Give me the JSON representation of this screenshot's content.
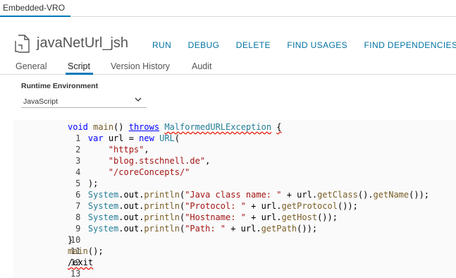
{
  "window": {
    "tab_label": "Embedded-VRO"
  },
  "header": {
    "title": "javaNetUrl_jsh",
    "actions": [
      "RUN",
      "DEBUG",
      "DELETE",
      "FIND USAGES",
      "FIND DEPENDENCIES"
    ]
  },
  "subtabs": [
    "General",
    "Script",
    "Version History",
    "Audit"
  ],
  "active_subtab": "Script",
  "runtime": {
    "label": "Runtime Environment",
    "selected": "JavaScript"
  },
  "editor": {
    "line_numbers": [
      "1",
      "2",
      "3",
      "4",
      "5",
      "6",
      "7",
      "8",
      "9",
      "10",
      "11",
      "12",
      "13"
    ],
    "lines": [
      "void main() throws MalformedURLException {",
      "    var url = new URL(",
      "        \"https\",",
      "        \"blog.stschnell.de\",",
      "        \"/coreConcepts/\"",
      "    );",
      "    System.out.println(\"Java class name: \" + url.getClass().getName());",
      "    System.out.println(\"Protocol: \" + url.getProtocol());",
      "    System.out.println(\"Hostname: \" + url.getHost());",
      "    System.out.println(\"Path: \" + url.getPath());",
      "}",
      "main();",
      "/exit"
    ]
  },
  "colors": {
    "accent": "#0079b8",
    "action_link": "#0072a3"
  },
  "icons": {
    "file": "file-code-icon",
    "dropdown": "chevron-down-icon"
  }
}
